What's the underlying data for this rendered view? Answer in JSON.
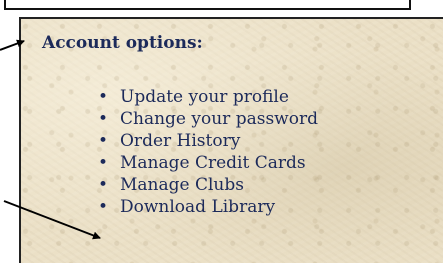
{
  "account": {
    "heading": "Account options:",
    "items": [
      {
        "label": "Update your profile"
      },
      {
        "label": "Change your password"
      },
      {
        "label": "Order History"
      },
      {
        "label": "Manage Credit Cards"
      },
      {
        "label": "Manage Clubs"
      },
      {
        "label": "Download Library"
      }
    ]
  },
  "bullet_char": "•",
  "colors": {
    "text": "#1c2a5a",
    "panel": "#ebe0c6",
    "annotation": "#000000"
  }
}
